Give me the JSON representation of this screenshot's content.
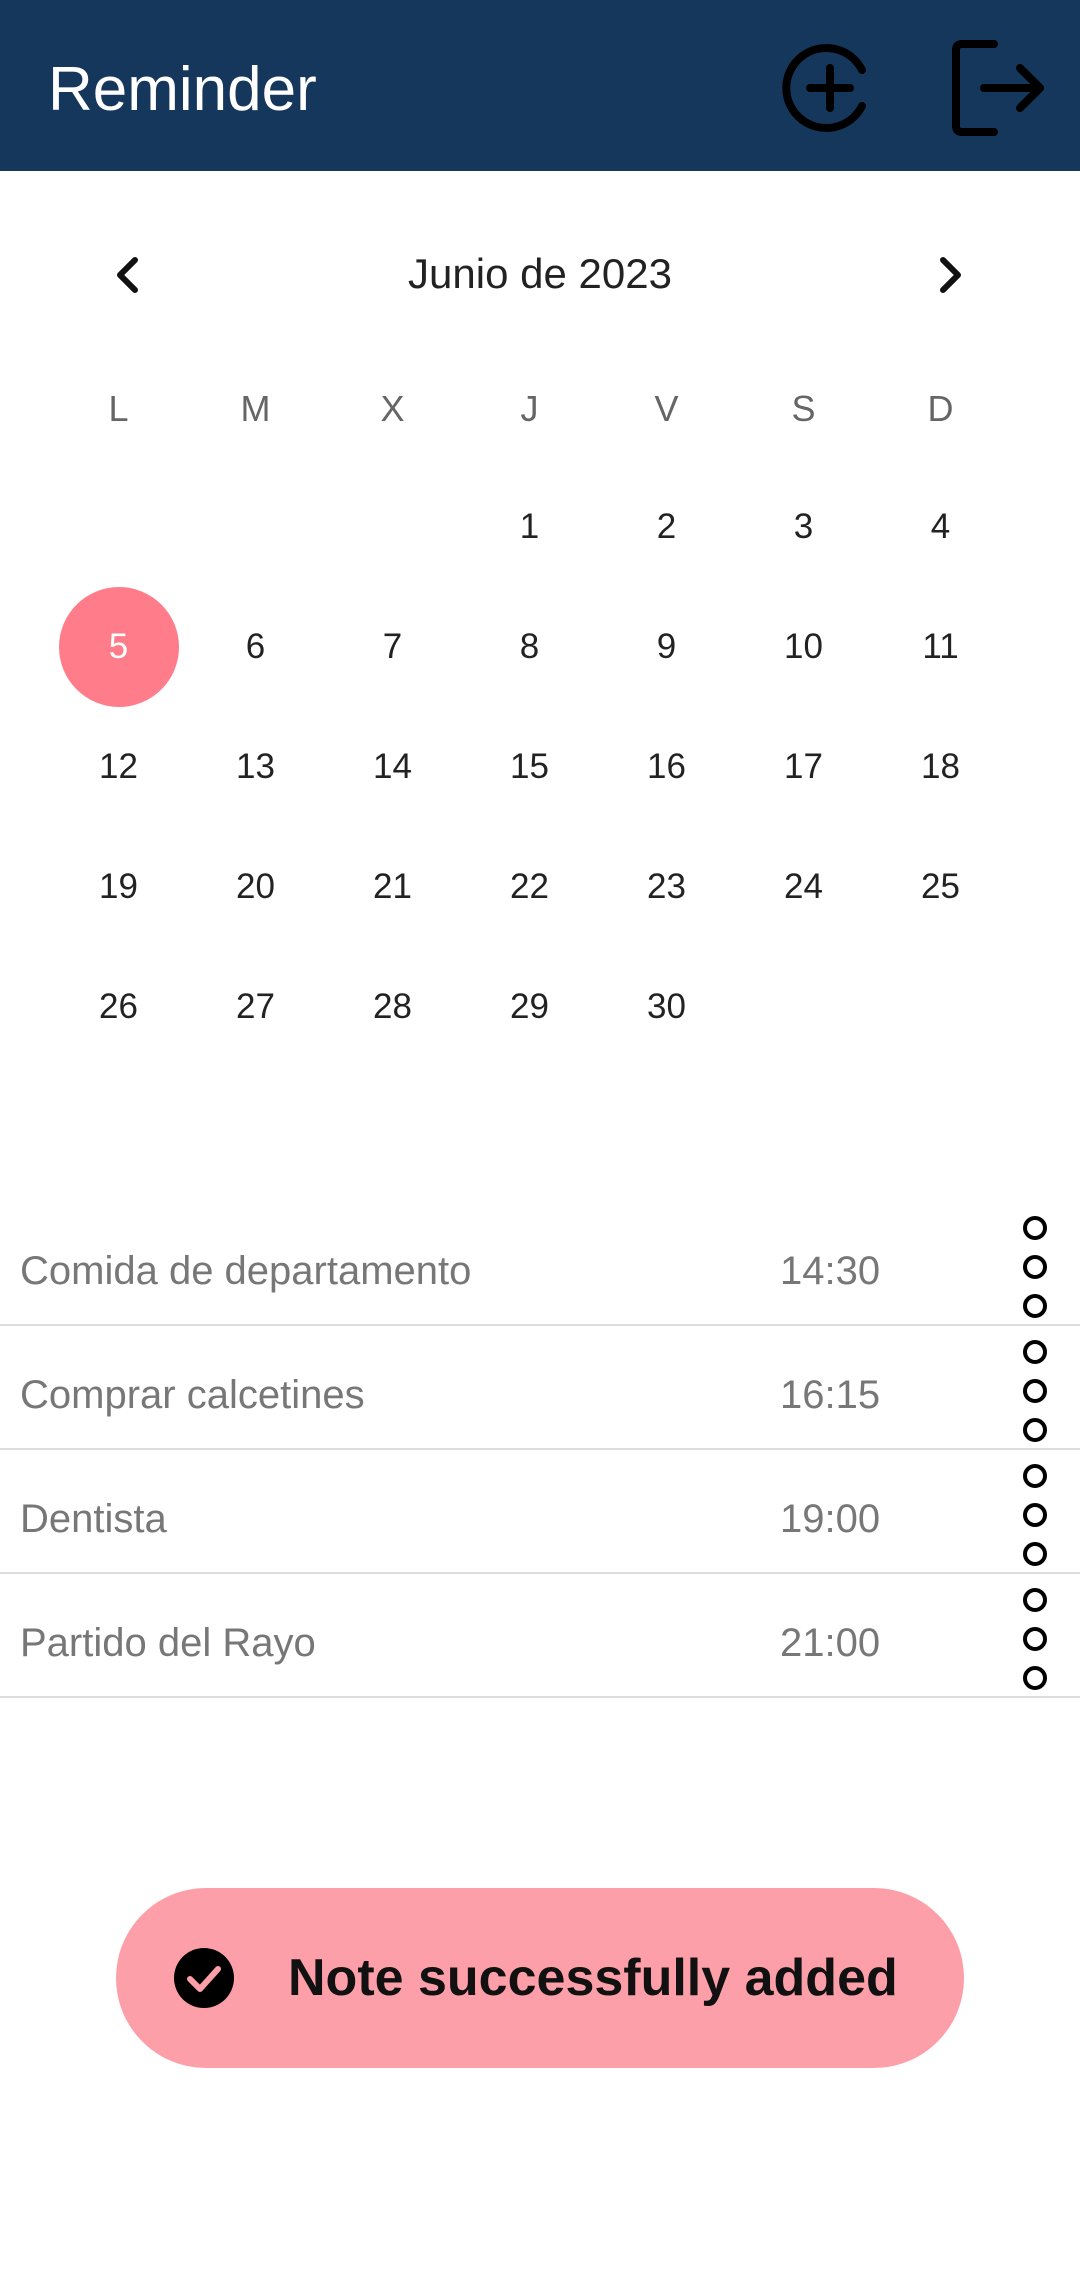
{
  "app": {
    "title": "Reminder"
  },
  "icons": {
    "add": "add-circle-icon",
    "logout": "logout-icon",
    "prev": "chevron-left-icon",
    "next": "chevron-right-icon",
    "more": "more-vert-icon",
    "check": "check-circle-icon"
  },
  "calendar": {
    "month_label": "Junio de 2023",
    "weekdays": [
      "L",
      "M",
      "X",
      "J",
      "V",
      "S",
      "D"
    ],
    "weeks": [
      [
        "",
        "",
        "",
        "1",
        "2",
        "3",
        "4"
      ],
      [
        "5",
        "6",
        "7",
        "8",
        "9",
        "10",
        "11"
      ],
      [
        "12",
        "13",
        "14",
        "15",
        "16",
        "17",
        "18"
      ],
      [
        "19",
        "20",
        "21",
        "22",
        "23",
        "24",
        "25"
      ],
      [
        "26",
        "27",
        "28",
        "29",
        "30",
        "",
        ""
      ]
    ],
    "selected_day": "5"
  },
  "reminders": [
    {
      "name": "Comida de departamento",
      "time": "14:30"
    },
    {
      "name": "Comprar calcetines",
      "time": "16:15"
    },
    {
      "name": "Dentista",
      "time": "19:00"
    },
    {
      "name": "Partido del Rayo",
      "time": "21:00"
    }
  ],
  "toast": {
    "message": "Note successfully added"
  },
  "colors": {
    "appbar": "#15375b",
    "selected_day": "#ff7d8b",
    "toast_bg": "#fd9fa8"
  }
}
